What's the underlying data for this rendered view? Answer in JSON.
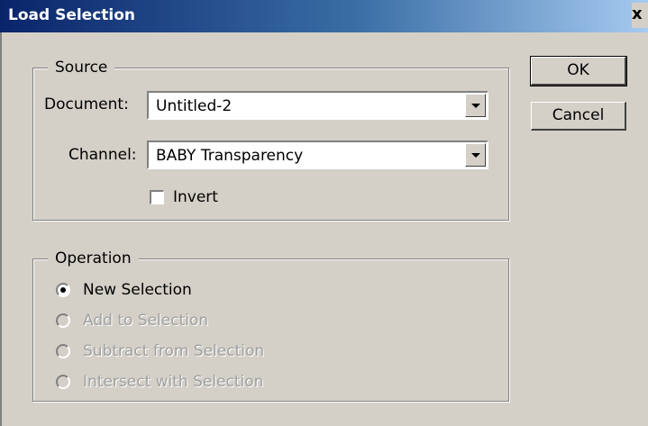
{
  "window": {
    "title": "Load Selection",
    "close_glyph": "x"
  },
  "source": {
    "legend": "Source",
    "document_label": "Document:",
    "document_value": "Untitled-2",
    "channel_label": "Channel:",
    "channel_value": "BABY Transparency",
    "invert_label": "Invert",
    "invert_checked": false
  },
  "operation": {
    "legend": "Operation",
    "options": [
      {
        "label": "New Selection",
        "selected": true,
        "enabled": true
      },
      {
        "label": "Add to Selection",
        "selected": false,
        "enabled": false
      },
      {
        "label": "Subtract from Selection",
        "selected": false,
        "enabled": false
      },
      {
        "label": "Intersect with Selection",
        "selected": false,
        "enabled": false
      }
    ]
  },
  "buttons": {
    "ok": "OK",
    "cancel": "Cancel"
  },
  "icons": {
    "dropdown": "chevron-down-icon",
    "close": "close-icon"
  }
}
